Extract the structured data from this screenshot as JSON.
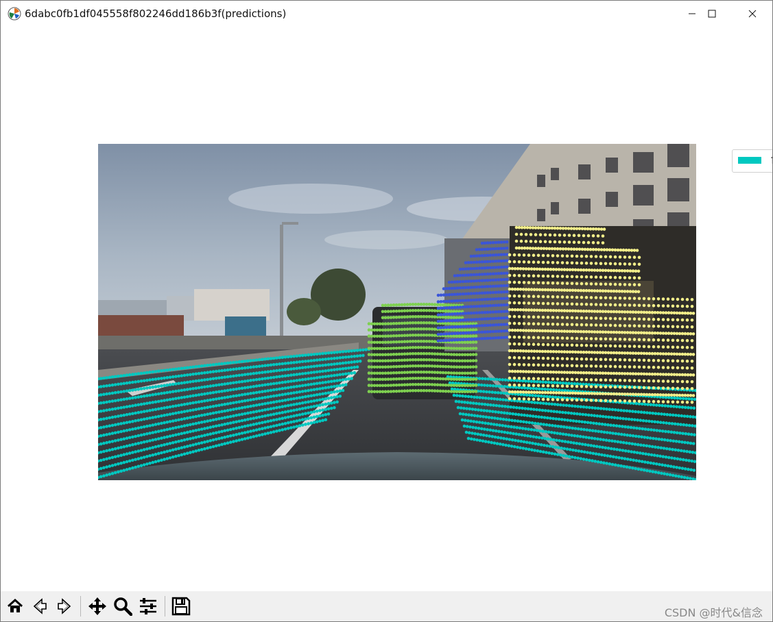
{
  "window": {
    "title": "6dabc0fb1df045558f802246dd186b3f(predictions)",
    "controls": [
      "minimize",
      "maximize",
      "close"
    ]
  },
  "legend": {
    "label": "f",
    "swatch_color": "#00c8c0"
  },
  "toolbar": {
    "buttons": [
      "home-icon",
      "back-icon",
      "forward-icon",
      "pan-icon",
      "zoom-icon",
      "configure-subplots-icon",
      "save-icon"
    ]
  },
  "watermark": "CSDN @时代&信念",
  "colors": {
    "road_points": "#00c8c0",
    "car_points": "#7ed050",
    "van_points": "#3a55d8",
    "truck_points": "#f2ee8a"
  }
}
